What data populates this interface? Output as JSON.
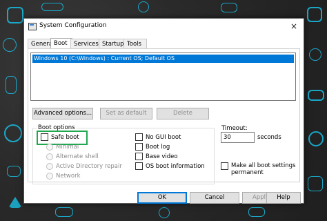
{
  "window": {
    "title": "System Configuration",
    "close_glyph": "×"
  },
  "tabs": [
    "General",
    "Boot",
    "Services",
    "Startup",
    "Tools"
  ],
  "os_list": {
    "selected_entry": "Windows 10 (C:\\Windows) : Current OS; Default OS"
  },
  "buttons": {
    "advanced": "Advanced options...",
    "set_default": "Set as default",
    "delete": "Delete",
    "ok": "OK",
    "cancel": "Cancel",
    "apply": "Apply",
    "help": "Help"
  },
  "boot_options": {
    "group_label": "Boot options",
    "safe_boot": "Safe boot",
    "radios": [
      "Minimal",
      "Alternate shell",
      "Active Directory repair",
      "Network"
    ],
    "no_gui_boot": "No GUI boot",
    "boot_log": "Boot log",
    "base_video": "Base video",
    "os_boot_info": "OS boot information"
  },
  "timeout": {
    "label": "Timeout:",
    "value": "30",
    "unit": "seconds"
  },
  "permanent": {
    "label_line1": "Make all boot settings",
    "label_line2": "permanent"
  },
  "colors": {
    "highlight": "#1fa84f",
    "selection": "#0078d7",
    "doodle": "#19b6d9"
  },
  "icons": [
    "window-icon",
    "close-icon"
  ]
}
